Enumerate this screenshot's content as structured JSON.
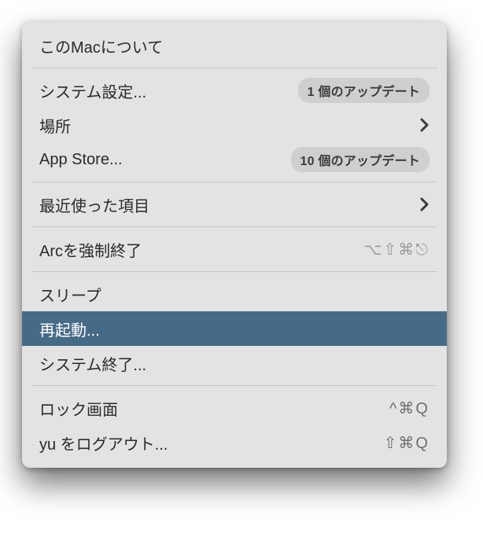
{
  "menu": {
    "about": "このMacについて",
    "system_settings": "システム設定...",
    "system_settings_badge": "1 個のアップデート",
    "location": "場所",
    "app_store": "App Store...",
    "app_store_badge": "10 個のアップデート",
    "recent_items": "最近使った項目",
    "force_quit": "Arcを強制終了",
    "force_quit_shortcut": "⌥⇧⌘⎋",
    "sleep": "スリープ",
    "restart": "再起動...",
    "shutdown": "システム終了...",
    "lock_screen": "ロック画面",
    "lock_screen_shortcut": "^⌘Q",
    "logout": "yu をログアウト...",
    "logout_shortcut": "⇧⌘Q"
  }
}
